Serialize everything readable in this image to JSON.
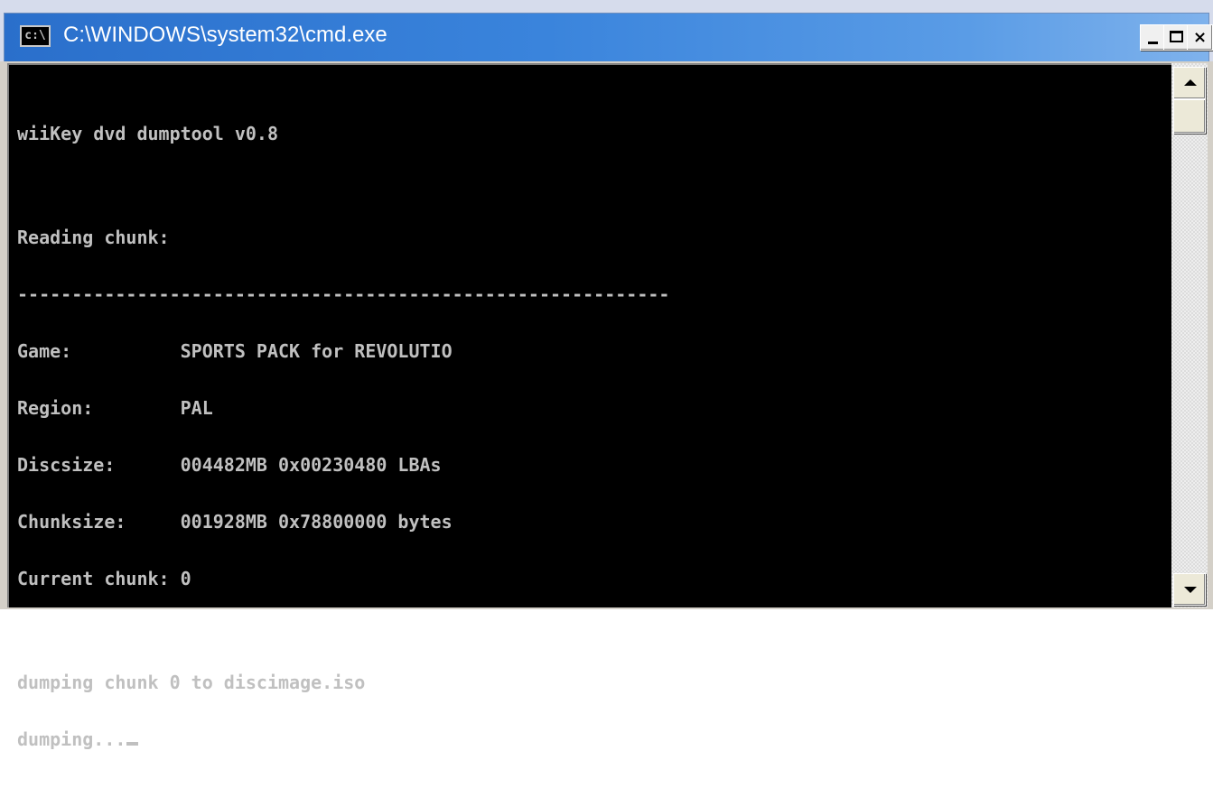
{
  "window": {
    "title": "C:\\WINDOWS\\system32\\cmd.exe",
    "icon_label": "c:\\",
    "controls": {
      "minimize": "minimize-icon",
      "maximize": "maximize-icon",
      "close": "close-icon",
      "close_glyph": "×"
    }
  },
  "console": {
    "lines": {
      "header": "wiiKey dvd dumptool v0.8",
      "reading": "Reading chunk:",
      "separator": "------------------------------------------------------------",
      "game": "Game:          SPORTS PACK for REVOLUTIO",
      "region": "Region:        PAL",
      "discsize": "Discsize:      004482MB 0x00230480 LBAs",
      "chunksize": "Chunksize:     001928MB 0x78800000 bytes",
      "current_chunk": "Current chunk: 0",
      "dumping_to": "dumping chunk 0 to discimage.iso",
      "progress": "dumping..."
    },
    "text_color": "#c0c0c0",
    "background_color": "#000000"
  },
  "scrollbar": {
    "up": "scroll-up-arrow-icon",
    "down": "scroll-down-arrow-icon"
  }
}
